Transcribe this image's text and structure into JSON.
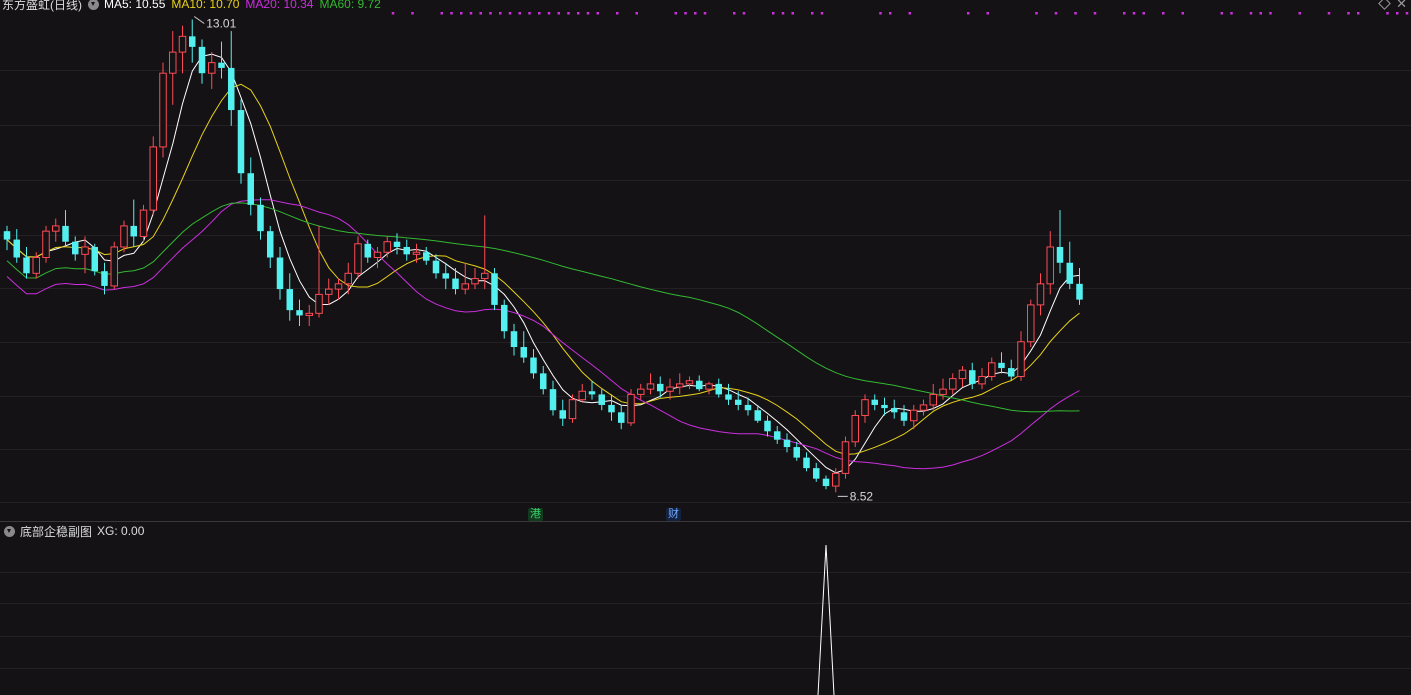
{
  "header": {
    "stock_name": "东方盛虹(日线)",
    "ma5": "MA5: 10.55",
    "ma10": "MA10: 10.70",
    "ma20": "MA20: 10.34",
    "ma60": "MA60: 9.72"
  },
  "sub_panel": {
    "title": "底部企稳副图",
    "xg": "XG: 0.00"
  },
  "markers": {
    "gang": "港",
    "cai": "财"
  },
  "colors": {
    "up": "#ff4a55",
    "down": "#54f0f0",
    "ma5": "#ffffff",
    "ma10": "#e8d21c",
    "ma20": "#cc2fe0",
    "ma60": "#33b832",
    "signal_dot": "#cc2fe0",
    "grid": "#242124"
  },
  "chart_data": {
    "type": "candlestick",
    "period": "daily",
    "max_label": "13.01",
    "min_label": "8.52",
    "y_range": [
      8.4,
      13.1
    ],
    "candles": [
      [
        11.0,
        11.05,
        10.82,
        10.92
      ],
      [
        10.92,
        11.02,
        10.7,
        10.75
      ],
      [
        10.75,
        10.85,
        10.55,
        10.6
      ],
      [
        10.6,
        10.8,
        10.55,
        10.75
      ],
      [
        10.75,
        11.05,
        10.7,
        11.0
      ],
      [
        11.0,
        11.12,
        10.9,
        11.05
      ],
      [
        11.05,
        11.2,
        10.85,
        10.9
      ],
      [
        10.9,
        10.95,
        10.72,
        10.78
      ],
      [
        10.78,
        10.95,
        10.6,
        10.85
      ],
      [
        10.85,
        10.88,
        10.58,
        10.62
      ],
      [
        10.62,
        10.7,
        10.4,
        10.48
      ],
      [
        10.48,
        10.9,
        10.45,
        10.85
      ],
      [
        10.85,
        11.1,
        10.8,
        11.05
      ],
      [
        11.05,
        11.3,
        10.85,
        10.95
      ],
      [
        10.95,
        11.25,
        10.9,
        11.2
      ],
      [
        11.2,
        11.9,
        11.15,
        11.8
      ],
      [
        11.8,
        12.6,
        11.7,
        12.5
      ],
      [
        12.5,
        12.9,
        12.2,
        12.7
      ],
      [
        12.7,
        12.95,
        12.5,
        12.85
      ],
      [
        12.85,
        13.01,
        12.6,
        12.75
      ],
      [
        12.75,
        12.82,
        12.4,
        12.5
      ],
      [
        12.5,
        12.7,
        12.35,
        12.6
      ],
      [
        12.6,
        12.8,
        12.45,
        12.55
      ],
      [
        12.55,
        12.9,
        12.0,
        12.15
      ],
      [
        12.15,
        12.25,
        11.45,
        11.55
      ],
      [
        11.55,
        11.7,
        11.15,
        11.25
      ],
      [
        11.25,
        11.32,
        10.92,
        11.0
      ],
      [
        11.0,
        11.05,
        10.65,
        10.75
      ],
      [
        10.75,
        10.85,
        10.35,
        10.45
      ],
      [
        10.45,
        10.6,
        10.15,
        10.25
      ],
      [
        10.25,
        10.35,
        10.1,
        10.2
      ],
      [
        10.2,
        10.3,
        10.1,
        10.22
      ],
      [
        10.22,
        11.05,
        10.18,
        10.4
      ],
      [
        10.4,
        10.55,
        10.3,
        10.45
      ],
      [
        10.45,
        10.55,
        10.35,
        10.5
      ],
      [
        10.5,
        10.7,
        10.4,
        10.6
      ],
      [
        10.6,
        10.95,
        10.55,
        10.88
      ],
      [
        10.88,
        10.92,
        10.7,
        10.75
      ],
      [
        10.75,
        10.85,
        10.65,
        10.8
      ],
      [
        10.8,
        10.95,
        10.75,
        10.9
      ],
      [
        10.9,
        10.98,
        10.78,
        10.85
      ],
      [
        10.85,
        10.92,
        10.72,
        10.78
      ],
      [
        10.78,
        10.88,
        10.7,
        10.8
      ],
      [
        10.8,
        10.85,
        10.68,
        10.72
      ],
      [
        10.72,
        10.78,
        10.55,
        10.6
      ],
      [
        10.6,
        10.7,
        10.45,
        10.55
      ],
      [
        10.55,
        10.65,
        10.4,
        10.45
      ],
      [
        10.45,
        10.7,
        10.4,
        10.5
      ],
      [
        10.5,
        10.65,
        10.45,
        10.55
      ],
      [
        10.55,
        11.15,
        10.45,
        10.6
      ],
      [
        10.6,
        10.65,
        10.25,
        10.3
      ],
      [
        10.3,
        10.35,
        9.98,
        10.05
      ],
      [
        10.05,
        10.12,
        9.82,
        9.9
      ],
      [
        9.9,
        10.05,
        9.75,
        9.8
      ],
      [
        9.8,
        9.88,
        9.6,
        9.65
      ],
      [
        9.65,
        9.72,
        9.45,
        9.5
      ],
      [
        9.5,
        9.58,
        9.25,
        9.3
      ],
      [
        9.3,
        9.4,
        9.15,
        9.22
      ],
      [
        9.22,
        9.45,
        9.18,
        9.4
      ],
      [
        9.4,
        9.55,
        9.38,
        9.48
      ],
      [
        9.48,
        9.58,
        9.4,
        9.45
      ],
      [
        9.45,
        9.5,
        9.3,
        9.35
      ],
      [
        9.35,
        9.45,
        9.2,
        9.28
      ],
      [
        9.28,
        9.35,
        9.12,
        9.18
      ],
      [
        9.18,
        9.5,
        9.15,
        9.45
      ],
      [
        9.45,
        9.55,
        9.4,
        9.5
      ],
      [
        9.5,
        9.65,
        9.45,
        9.55
      ],
      [
        9.55,
        9.62,
        9.42,
        9.48
      ],
      [
        9.48,
        9.6,
        9.4,
        9.52
      ],
      [
        9.52,
        9.65,
        9.45,
        9.55
      ],
      [
        9.55,
        9.62,
        9.5,
        9.58
      ],
      [
        9.58,
        9.63,
        9.48,
        9.5
      ],
      [
        9.5,
        9.57,
        9.45,
        9.55
      ],
      [
        9.55,
        9.6,
        9.42,
        9.45
      ],
      [
        9.45,
        9.55,
        9.35,
        9.4
      ],
      [
        9.4,
        9.48,
        9.3,
        9.35
      ],
      [
        9.35,
        9.42,
        9.25,
        9.3
      ],
      [
        9.3,
        9.35,
        9.18,
        9.2
      ],
      [
        9.2,
        9.25,
        9.05,
        9.1
      ],
      [
        9.1,
        9.15,
        8.98,
        9.02
      ],
      [
        9.02,
        9.08,
        8.9,
        8.95
      ],
      [
        8.95,
        9.0,
        8.82,
        8.85
      ],
      [
        8.85,
        8.9,
        8.72,
        8.75
      ],
      [
        8.75,
        8.8,
        8.62,
        8.65
      ],
      [
        8.65,
        8.68,
        8.55,
        8.58
      ],
      [
        8.58,
        8.75,
        8.52,
        8.7
      ],
      [
        8.7,
        9.05,
        8.65,
        9.0
      ],
      [
        9.0,
        9.3,
        8.95,
        9.25
      ],
      [
        9.25,
        9.45,
        9.18,
        9.4
      ],
      [
        9.4,
        9.45,
        9.3,
        9.35
      ],
      [
        9.35,
        9.42,
        9.25,
        9.32
      ],
      [
        9.32,
        9.4,
        9.22,
        9.28
      ],
      [
        9.28,
        9.35,
        9.15,
        9.2
      ],
      [
        9.2,
        9.35,
        9.12,
        9.3
      ],
      [
        9.3,
        9.4,
        9.25,
        9.35
      ],
      [
        9.35,
        9.55,
        9.3,
        9.45
      ],
      [
        9.45,
        9.6,
        9.4,
        9.5
      ],
      [
        9.5,
        9.65,
        9.45,
        9.6
      ],
      [
        9.6,
        9.72,
        9.52,
        9.68
      ],
      [
        9.68,
        9.75,
        9.5,
        9.55
      ],
      [
        9.55,
        9.7,
        9.5,
        9.62
      ],
      [
        9.62,
        9.8,
        9.58,
        9.75
      ],
      [
        9.75,
        9.85,
        9.65,
        9.7
      ],
      [
        9.7,
        9.78,
        9.58,
        9.62
      ],
      [
        9.62,
        10.05,
        9.58,
        9.95
      ],
      [
        9.95,
        10.35,
        9.9,
        10.3
      ],
      [
        10.3,
        10.6,
        10.2,
        10.5
      ],
      [
        10.5,
        11.0,
        10.4,
        10.85
      ],
      [
        10.85,
        11.2,
        10.6,
        10.7
      ],
      [
        10.7,
        10.9,
        10.45,
        10.5
      ],
      [
        10.5,
        10.65,
        10.3,
        10.35
      ]
    ],
    "ma_series": [
      {
        "name": "MA5"
      },
      {
        "name": "MA10"
      },
      {
        "name": "MA20"
      },
      {
        "name": "MA60"
      }
    ],
    "signal_dot_columns": [
      29,
      31,
      34,
      35,
      36,
      37,
      38,
      39,
      40,
      41,
      42,
      43,
      44,
      45,
      46,
      47,
      48,
      49,
      50,
      52,
      54,
      58,
      59,
      60,
      61,
      64,
      65,
      68,
      69,
      70,
      72,
      73,
      79,
      80,
      82,
      88,
      90,
      95,
      97,
      99,
      101,
      104,
      105,
      106,
      108,
      110,
      114,
      115,
      117,
      118,
      119,
      122,
      125,
      127,
      128,
      131,
      132,
      133,
      136
    ],
    "sub_indicator": {
      "name": "XG",
      "spike_index": 84,
      "spike_value": 1
    }
  }
}
